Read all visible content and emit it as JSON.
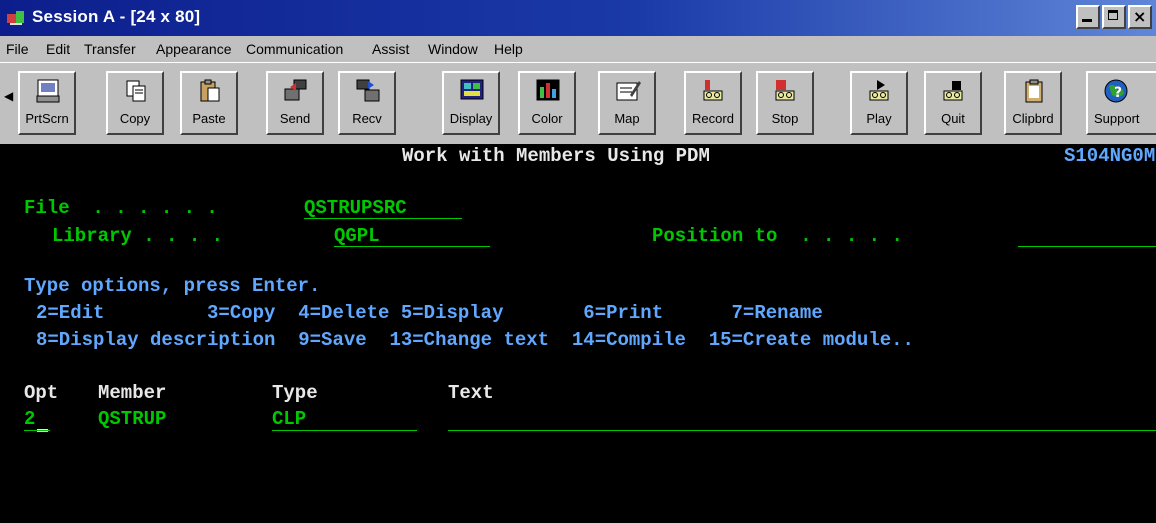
{
  "window": {
    "title": "Session A - [24 x 80]",
    "buttons": {
      "minimize": "_",
      "maximize": "□",
      "close": "×"
    }
  },
  "menu": [
    "File",
    "Edit",
    "Transfer",
    "Appearance",
    "Communication",
    "Assist",
    "Window",
    "Help"
  ],
  "toolbar": {
    "buttons": [
      {
        "label": "PrtScrn",
        "icon": "print-screen-icon"
      },
      {
        "label": "Copy",
        "icon": "copy-icon"
      },
      {
        "label": "Paste",
        "icon": "paste-icon"
      },
      {
        "label": "Send",
        "icon": "send-icon"
      },
      {
        "label": "Recv",
        "icon": "receive-icon"
      },
      {
        "label": "Display",
        "icon": "display-icon"
      },
      {
        "label": "Color",
        "icon": "color-icon"
      },
      {
        "label": "Map",
        "icon": "map-icon"
      },
      {
        "label": "Record",
        "icon": "record-icon"
      },
      {
        "label": "Stop",
        "icon": "stop-icon"
      },
      {
        "label": "Play",
        "icon": "play-icon"
      },
      {
        "label": "Quit",
        "icon": "quit-icon"
      },
      {
        "label": "Clipbrd",
        "icon": "clipboard-icon"
      },
      {
        "label": "Support",
        "icon": "support-icon"
      }
    ]
  },
  "terminal": {
    "heading": "Work with Members Using PDM",
    "system": "S104NG0M",
    "file_label": "File  . . . . . .",
    "file_value": "QSTRUPSRC",
    "library_label": "Library . . . .",
    "library_value": "QGPL",
    "position_label": "Position to  . . . . .",
    "position_value": "",
    "instructions": "Type options, press Enter.",
    "options_line1": "2=Edit         3=Copy  4=Delete 5=Display       6=Print      7=Rename",
    "options_line2": "8=Display description  9=Save  13=Change text  14=Compile  15=Create module..",
    "columns": {
      "opt": "Opt",
      "member": "Member",
      "type": "Type",
      "text": "Text"
    },
    "rows": [
      {
        "opt": "2",
        "member": "QSTRUP",
        "type": "CLP",
        "text": ""
      }
    ]
  },
  "colors": {
    "terminal_bg": "#000000",
    "field_green": "#00c800",
    "heading_white": "#e8e8e8",
    "prompt_blue": "#60a8ff",
    "titlebar": "#0c1e8c"
  }
}
